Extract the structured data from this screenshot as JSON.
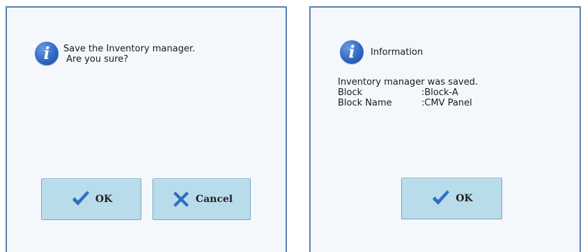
{
  "confirm_dialog": {
    "icon": "info-icon",
    "message_line1": "Save the Inventory manager.",
    "message_line2": " Are you sure?",
    "ok_label": "OK",
    "cancel_label": "Cancel"
  },
  "info_dialog": {
    "icon": "info-icon",
    "title": "Information",
    "message": "Inventory manager was saved.",
    "block_label": "Block",
    "block_value": ":Block-A",
    "block_name_label": "Block Name",
    "block_name_value": ":CMV Panel",
    "ok_label": "OK"
  },
  "colors": {
    "dialog_bg": "#f4f8fc",
    "dialog_border": "#5a7fb0",
    "button_bg": "#b8dcea",
    "check_icon": "#2f6fc0",
    "cancel_icon": "#2f6fc0"
  }
}
